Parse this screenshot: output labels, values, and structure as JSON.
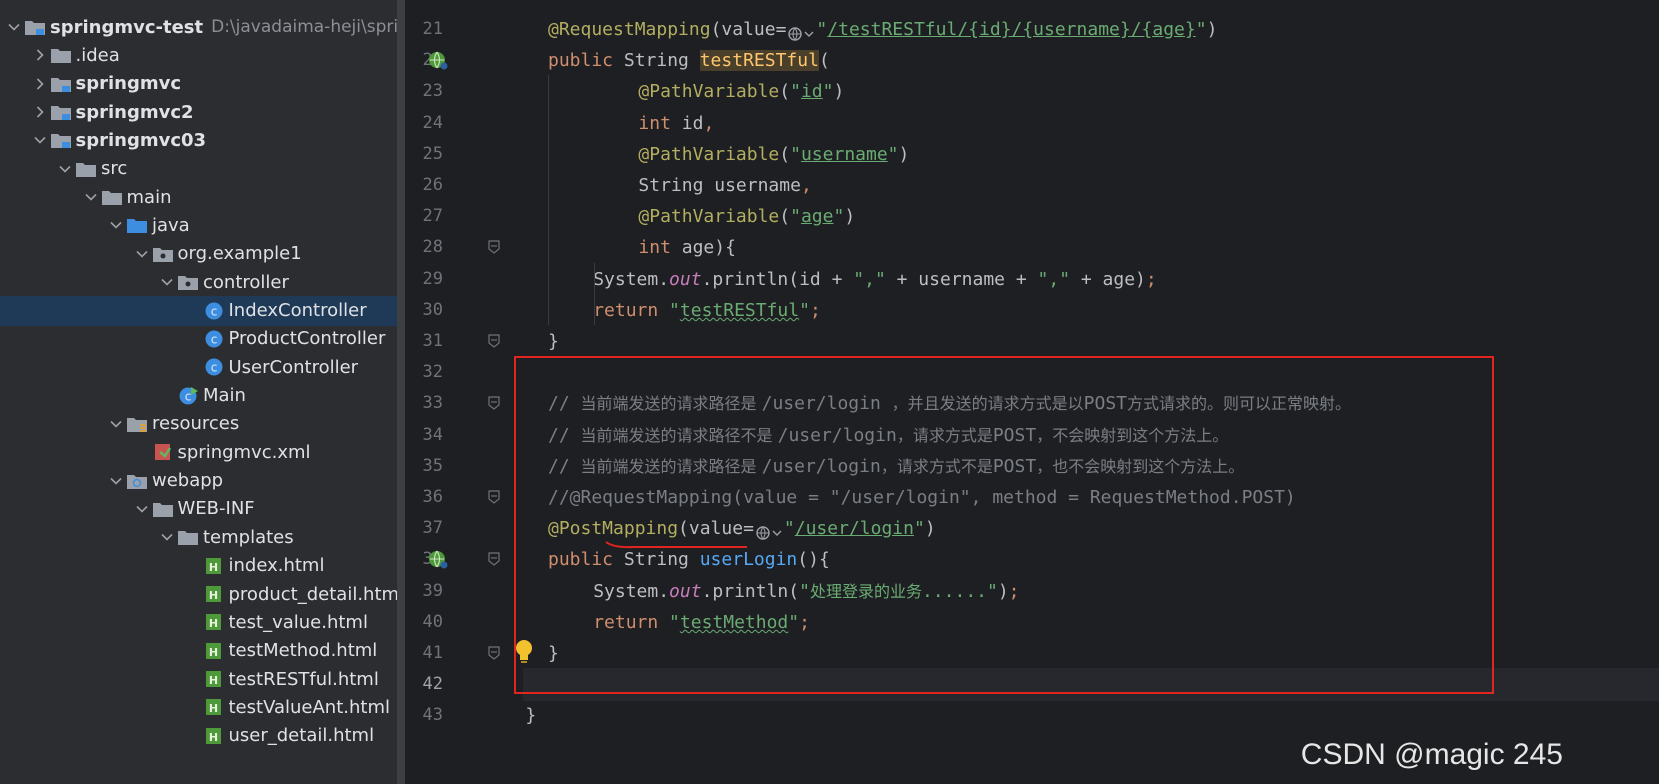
{
  "project_tree": {
    "items": [
      {
        "label": "springmvc-test",
        "path": "D:\\javadaima-heji\\spring",
        "bold": true,
        "indent": 0,
        "chevron": "down",
        "icon": "module-folder-icon"
      },
      {
        "label": ".idea",
        "indent": 1,
        "chevron": "right",
        "icon": "folder-icon"
      },
      {
        "label": "springmvc",
        "bold": true,
        "indent": 1,
        "chevron": "right",
        "icon": "module-folder-icon"
      },
      {
        "label": "springmvc2",
        "bold": true,
        "indent": 1,
        "chevron": "right",
        "icon": "module-folder-icon"
      },
      {
        "label": "springmvc03",
        "bold": true,
        "indent": 1,
        "chevron": "down",
        "icon": "module-folder-icon"
      },
      {
        "label": "src",
        "indent": 2,
        "chevron": "down",
        "icon": "folder-icon"
      },
      {
        "label": "main",
        "indent": 3,
        "chevron": "down",
        "icon": "folder-icon"
      },
      {
        "label": "java",
        "indent": 4,
        "chevron": "down",
        "icon": "source-folder-icon"
      },
      {
        "label": "org.example1",
        "indent": 5,
        "chevron": "down",
        "icon": "package-icon"
      },
      {
        "label": "controller",
        "indent": 6,
        "chevron": "down",
        "icon": "package-icon"
      },
      {
        "label": "IndexController",
        "indent": 7,
        "chevron": "none",
        "icon": "java-class-icon",
        "selected": true
      },
      {
        "label": "ProductController",
        "indent": 7,
        "chevron": "none",
        "icon": "java-class-icon"
      },
      {
        "label": "UserController",
        "indent": 7,
        "chevron": "none",
        "icon": "java-class-icon"
      },
      {
        "label": "Main",
        "indent": 6,
        "chevron": "none",
        "icon": "java-main-class-icon"
      },
      {
        "label": "resources",
        "indent": 4,
        "chevron": "down",
        "icon": "resources-folder-icon"
      },
      {
        "label": "springmvc.xml",
        "indent": 5,
        "chevron": "none",
        "icon": "xml-file-icon"
      },
      {
        "label": "webapp",
        "indent": 4,
        "chevron": "down",
        "icon": "web-folder-icon"
      },
      {
        "label": "WEB-INF",
        "indent": 5,
        "chevron": "down",
        "icon": "folder-icon"
      },
      {
        "label": "templates",
        "indent": 6,
        "chevron": "down",
        "icon": "folder-icon"
      },
      {
        "label": "index.html",
        "indent": 7,
        "chevron": "none",
        "icon": "html-file-icon"
      },
      {
        "label": "product_detail.html",
        "indent": 7,
        "chevron": "none",
        "icon": "html-file-icon"
      },
      {
        "label": "test_value.html",
        "indent": 7,
        "chevron": "none",
        "icon": "html-file-icon"
      },
      {
        "label": "testMethod.html",
        "indent": 7,
        "chevron": "none",
        "icon": "html-file-icon"
      },
      {
        "label": "testRESTful.html",
        "indent": 7,
        "chevron": "none",
        "icon": "html-file-icon"
      },
      {
        "label": "testValueAnt.html",
        "indent": 7,
        "chevron": "none",
        "icon": "html-file-icon"
      },
      {
        "label": "user_detail.html",
        "indent": 7,
        "chevron": "none",
        "icon": "html-file-icon"
      }
    ]
  },
  "editor": {
    "current_line": 42,
    "gutter_icons": [
      {
        "line": 22,
        "icon": "web-endpoint-icon"
      },
      {
        "line": 38,
        "icon": "web-endpoint-icon"
      }
    ],
    "fold_markers": [
      28,
      31,
      33,
      36,
      38,
      41
    ],
    "lines": [
      {
        "num": 21,
        "indent": 0,
        "tokens": [
          [
            "ann",
            "@RequestMapping"
          ],
          [
            "plain",
            "(value="
          ],
          [
            "hint",
            "url-hint-icon"
          ],
          [
            "str",
            "\""
          ],
          [
            "str-ul",
            "/testRESTful/{id}/{username}/{age}"
          ],
          [
            "str",
            "\""
          ],
          [
            "plain",
            ")"
          ]
        ]
      },
      {
        "num": 22,
        "indent": 0,
        "tokens": [
          [
            "kw",
            "public "
          ],
          [
            "plain",
            "String "
          ],
          [
            "fnhl",
            "testRESTful"
          ],
          [
            "plain",
            "("
          ]
        ]
      },
      {
        "num": 23,
        "indent": 8,
        "tokens": [
          [
            "ann",
            "@PathVariable"
          ],
          [
            "plain",
            "("
          ],
          [
            "str",
            "\""
          ],
          [
            "str-ul",
            "id"
          ],
          [
            "str",
            "\""
          ],
          [
            "plain",
            ")"
          ]
        ]
      },
      {
        "num": 24,
        "indent": 8,
        "tokens": [
          [
            "kw",
            "int "
          ],
          [
            "plain",
            "id"
          ],
          [
            "kw",
            ","
          ]
        ]
      },
      {
        "num": 25,
        "indent": 8,
        "tokens": [
          [
            "ann",
            "@PathVariable"
          ],
          [
            "plain",
            "("
          ],
          [
            "str",
            "\""
          ],
          [
            "str-ul",
            "username"
          ],
          [
            "str",
            "\""
          ],
          [
            "plain",
            ")"
          ]
        ]
      },
      {
        "num": 26,
        "indent": 8,
        "tokens": [
          [
            "plain",
            "String username"
          ],
          [
            "kw",
            ","
          ]
        ]
      },
      {
        "num": 27,
        "indent": 8,
        "tokens": [
          [
            "ann",
            "@PathVariable"
          ],
          [
            "plain",
            "("
          ],
          [
            "str",
            "\""
          ],
          [
            "str-ul",
            "age"
          ],
          [
            "str",
            "\""
          ],
          [
            "plain",
            ")"
          ]
        ]
      },
      {
        "num": 28,
        "indent": 8,
        "tokens": [
          [
            "kw",
            "int "
          ],
          [
            "plain",
            "age){"
          ]
        ]
      },
      {
        "num": 29,
        "indent": 4,
        "tokens": [
          [
            "plain",
            "System."
          ],
          [
            "fld",
            "out"
          ],
          [
            "plain",
            ".println(id + "
          ],
          [
            "str",
            "\",\""
          ],
          [
            "plain",
            " + username + "
          ],
          [
            "str",
            "\",\""
          ],
          [
            "plain",
            " + age)"
          ],
          [
            "kw",
            ";"
          ]
        ]
      },
      {
        "num": 30,
        "indent": 4,
        "tokens": [
          [
            "kw",
            "return "
          ],
          [
            "str",
            "\""
          ],
          [
            "str-sq",
            "testRESTful"
          ],
          [
            "str",
            "\""
          ],
          [
            "kw",
            ";"
          ]
        ]
      },
      {
        "num": 31,
        "indent": 0,
        "tokens": [
          [
            "plain",
            "}"
          ]
        ]
      },
      {
        "num": 32,
        "indent": 0,
        "tokens": []
      },
      {
        "num": 33,
        "indent": 0,
        "tokens": [
          [
            "cmt",
            "// "
          ],
          [
            "cmt-cjk",
            "当前端发送的请求路径是 "
          ],
          [
            "cmt",
            "/user/login "
          ],
          [
            "cmt-cjk",
            "，并且发送的请求方式是以"
          ],
          [
            "cmt",
            "POST"
          ],
          [
            "cmt-cjk",
            "方式请求的。则可以正常映射。"
          ]
        ]
      },
      {
        "num": 34,
        "indent": 0,
        "tokens": [
          [
            "cmt",
            "// "
          ],
          [
            "cmt-cjk",
            "当前端发送的请求路径不是 "
          ],
          [
            "cmt",
            "/user/login"
          ],
          [
            "cmt-cjk",
            "，请求方式是"
          ],
          [
            "cmt",
            "POST"
          ],
          [
            "cmt-cjk",
            "，不会映射到这个方法上。"
          ]
        ]
      },
      {
        "num": 35,
        "indent": 0,
        "tokens": [
          [
            "cmt",
            "// "
          ],
          [
            "cmt-cjk",
            "当前端发送的请求路径是 "
          ],
          [
            "cmt",
            "/user/login"
          ],
          [
            "cmt-cjk",
            "，请求方式不是"
          ],
          [
            "cmt",
            "POST"
          ],
          [
            "cmt-cjk",
            "，也不会映射到这个方法上。"
          ]
        ]
      },
      {
        "num": 36,
        "indent": 0,
        "tokens": [
          [
            "cmt",
            "//@RequestMapping(value = \"/user/login\", method = RequestMethod.POST)"
          ]
        ]
      },
      {
        "num": 37,
        "indent": 0,
        "tokens": [
          [
            "ann",
            "@PostMapping"
          ],
          [
            "plain",
            "(value="
          ],
          [
            "hint",
            "url-hint-icon"
          ],
          [
            "str",
            "\""
          ],
          [
            "str-ul",
            "/user/login"
          ],
          [
            "str",
            "\""
          ],
          [
            "plain",
            ")"
          ]
        ]
      },
      {
        "num": 38,
        "indent": 0,
        "tokens": [
          [
            "kw",
            "public "
          ],
          [
            "plain",
            "String "
          ],
          [
            "fn",
            "userLogin"
          ],
          [
            "plain",
            "(){"
          ]
        ]
      },
      {
        "num": 39,
        "indent": 4,
        "tokens": [
          [
            "plain",
            "System."
          ],
          [
            "fld",
            "out"
          ],
          [
            "plain",
            ".println("
          ],
          [
            "str",
            "\""
          ],
          [
            "str-cjk",
            "处理登录的业务"
          ],
          [
            "str",
            "......\""
          ],
          [
            "plain",
            ")"
          ],
          [
            "kw",
            ";"
          ]
        ]
      },
      {
        "num": 40,
        "indent": 4,
        "tokens": [
          [
            "kw",
            "return "
          ],
          [
            "str",
            "\""
          ],
          [
            "str-sq",
            "testMethod"
          ],
          [
            "str",
            "\""
          ],
          [
            "kw",
            ";"
          ]
        ]
      },
      {
        "num": 41,
        "indent": 0,
        "tokens": [
          [
            "plain",
            "}"
          ]
        ]
      },
      {
        "num": 42,
        "indent": 0,
        "tokens": []
      },
      {
        "num": 43,
        "indent": -2,
        "tokens": [
          [
            "plain",
            "}"
          ]
        ]
      }
    ]
  },
  "watermark": "CSDN @magic 245",
  "colors": {
    "highlight_box": "#e0261f",
    "selection": "#1e3a57",
    "keyword": "#cf8e6d",
    "annotation": "#b3ae60",
    "string": "#6aab73",
    "comment": "#7a7e85"
  }
}
